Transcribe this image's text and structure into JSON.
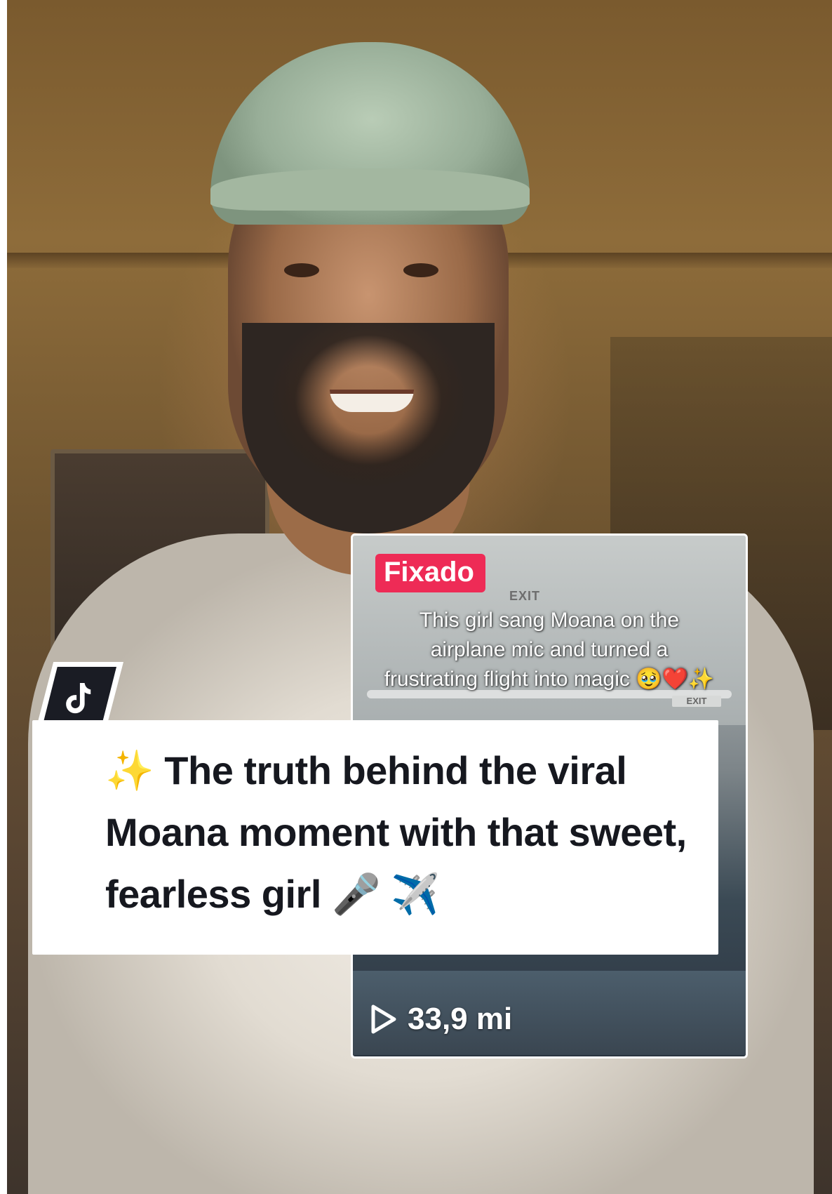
{
  "tiktok": {
    "logo_icon": "tiktok-logo-icon"
  },
  "pinned_video": {
    "tag": "Fixado",
    "exit_sign": "EXIT",
    "exit_sign_small": "EXIT",
    "caption": "This girl sang Moana on the airplane mic and turned a frustrating flight into magic 🥹❤️✨",
    "views_icon": "play-outline-icon",
    "views": "33,9 mi"
  },
  "caption_card": {
    "text": "✨ The truth behind the viral Moana moment with that sweet, fearless girl 🎤 ✈️"
  },
  "colors": {
    "pinned_tag": "#ee2b56",
    "caption_text": "#16181f",
    "logo_bg": "#1a1c24"
  }
}
